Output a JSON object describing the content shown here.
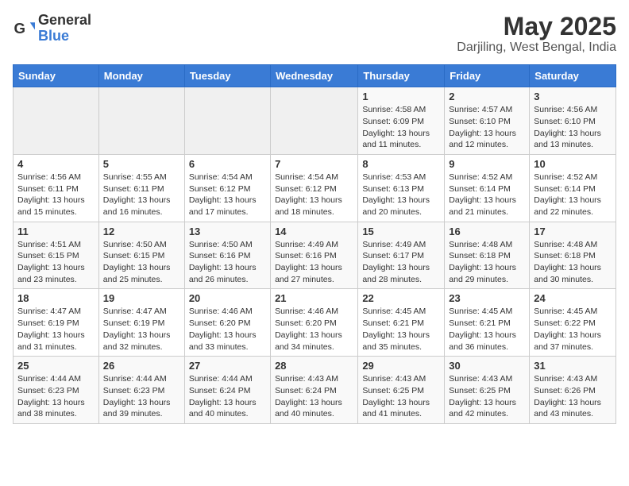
{
  "header": {
    "logo_general": "General",
    "logo_blue": "Blue",
    "month_year": "May 2025",
    "location": "Darjiling, West Bengal, India"
  },
  "days_of_week": [
    "Sunday",
    "Monday",
    "Tuesday",
    "Wednesday",
    "Thursday",
    "Friday",
    "Saturday"
  ],
  "weeks": [
    [
      {
        "day": "",
        "info": ""
      },
      {
        "day": "",
        "info": ""
      },
      {
        "day": "",
        "info": ""
      },
      {
        "day": "",
        "info": ""
      },
      {
        "day": "1",
        "info": "Sunrise: 4:58 AM\nSunset: 6:09 PM\nDaylight: 13 hours\nand 11 minutes."
      },
      {
        "day": "2",
        "info": "Sunrise: 4:57 AM\nSunset: 6:10 PM\nDaylight: 13 hours\nand 12 minutes."
      },
      {
        "day": "3",
        "info": "Sunrise: 4:56 AM\nSunset: 6:10 PM\nDaylight: 13 hours\nand 13 minutes."
      }
    ],
    [
      {
        "day": "4",
        "info": "Sunrise: 4:56 AM\nSunset: 6:11 PM\nDaylight: 13 hours\nand 15 minutes."
      },
      {
        "day": "5",
        "info": "Sunrise: 4:55 AM\nSunset: 6:11 PM\nDaylight: 13 hours\nand 16 minutes."
      },
      {
        "day": "6",
        "info": "Sunrise: 4:54 AM\nSunset: 6:12 PM\nDaylight: 13 hours\nand 17 minutes."
      },
      {
        "day": "7",
        "info": "Sunrise: 4:54 AM\nSunset: 6:12 PM\nDaylight: 13 hours\nand 18 minutes."
      },
      {
        "day": "8",
        "info": "Sunrise: 4:53 AM\nSunset: 6:13 PM\nDaylight: 13 hours\nand 20 minutes."
      },
      {
        "day": "9",
        "info": "Sunrise: 4:52 AM\nSunset: 6:14 PM\nDaylight: 13 hours\nand 21 minutes."
      },
      {
        "day": "10",
        "info": "Sunrise: 4:52 AM\nSunset: 6:14 PM\nDaylight: 13 hours\nand 22 minutes."
      }
    ],
    [
      {
        "day": "11",
        "info": "Sunrise: 4:51 AM\nSunset: 6:15 PM\nDaylight: 13 hours\nand 23 minutes."
      },
      {
        "day": "12",
        "info": "Sunrise: 4:50 AM\nSunset: 6:15 PM\nDaylight: 13 hours\nand 25 minutes."
      },
      {
        "day": "13",
        "info": "Sunrise: 4:50 AM\nSunset: 6:16 PM\nDaylight: 13 hours\nand 26 minutes."
      },
      {
        "day": "14",
        "info": "Sunrise: 4:49 AM\nSunset: 6:16 PM\nDaylight: 13 hours\nand 27 minutes."
      },
      {
        "day": "15",
        "info": "Sunrise: 4:49 AM\nSunset: 6:17 PM\nDaylight: 13 hours\nand 28 minutes."
      },
      {
        "day": "16",
        "info": "Sunrise: 4:48 AM\nSunset: 6:18 PM\nDaylight: 13 hours\nand 29 minutes."
      },
      {
        "day": "17",
        "info": "Sunrise: 4:48 AM\nSunset: 6:18 PM\nDaylight: 13 hours\nand 30 minutes."
      }
    ],
    [
      {
        "day": "18",
        "info": "Sunrise: 4:47 AM\nSunset: 6:19 PM\nDaylight: 13 hours\nand 31 minutes."
      },
      {
        "day": "19",
        "info": "Sunrise: 4:47 AM\nSunset: 6:19 PM\nDaylight: 13 hours\nand 32 minutes."
      },
      {
        "day": "20",
        "info": "Sunrise: 4:46 AM\nSunset: 6:20 PM\nDaylight: 13 hours\nand 33 minutes."
      },
      {
        "day": "21",
        "info": "Sunrise: 4:46 AM\nSunset: 6:20 PM\nDaylight: 13 hours\nand 34 minutes."
      },
      {
        "day": "22",
        "info": "Sunrise: 4:45 AM\nSunset: 6:21 PM\nDaylight: 13 hours\nand 35 minutes."
      },
      {
        "day": "23",
        "info": "Sunrise: 4:45 AM\nSunset: 6:21 PM\nDaylight: 13 hours\nand 36 minutes."
      },
      {
        "day": "24",
        "info": "Sunrise: 4:45 AM\nSunset: 6:22 PM\nDaylight: 13 hours\nand 37 minutes."
      }
    ],
    [
      {
        "day": "25",
        "info": "Sunrise: 4:44 AM\nSunset: 6:23 PM\nDaylight: 13 hours\nand 38 minutes."
      },
      {
        "day": "26",
        "info": "Sunrise: 4:44 AM\nSunset: 6:23 PM\nDaylight: 13 hours\nand 39 minutes."
      },
      {
        "day": "27",
        "info": "Sunrise: 4:44 AM\nSunset: 6:24 PM\nDaylight: 13 hours\nand 40 minutes."
      },
      {
        "day": "28",
        "info": "Sunrise: 4:43 AM\nSunset: 6:24 PM\nDaylight: 13 hours\nand 40 minutes."
      },
      {
        "day": "29",
        "info": "Sunrise: 4:43 AM\nSunset: 6:25 PM\nDaylight: 13 hours\nand 41 minutes."
      },
      {
        "day": "30",
        "info": "Sunrise: 4:43 AM\nSunset: 6:25 PM\nDaylight: 13 hours\nand 42 minutes."
      },
      {
        "day": "31",
        "info": "Sunrise: 4:43 AM\nSunset: 6:26 PM\nDaylight: 13 hours\nand 43 minutes."
      }
    ]
  ]
}
